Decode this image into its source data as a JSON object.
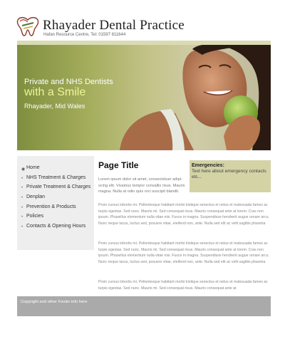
{
  "header": {
    "title": "Rhayader Dental Practice",
    "subtitle": "Hafan Resource Centre, Tel: 01597 811644"
  },
  "hero": {
    "line1": "Private and NHS Dentists",
    "line2": "with a Smile",
    "line3": "Rhayader, Mid Wales"
  },
  "sidebar": {
    "items": [
      {
        "label": "Home",
        "active": true
      },
      {
        "label": "NHS Treatment & Charges"
      },
      {
        "label": "Private Treatment & Charges"
      },
      {
        "label": "Denplan"
      },
      {
        "label": "Prevention & Products"
      },
      {
        "label": "Policies"
      },
      {
        "label": "Contacts & Opening Hours"
      }
    ]
  },
  "main": {
    "page_title": "Page Title",
    "intro": "Lorem ipsum dolor sit amet, consectetuer adipi-scing elit. Vivamus tempor convallis risus. Mauris magna. Nulla at odio quis orci suscipit blandit.",
    "paragraphs": [
      "Proin cursus lobortis mi. Pellentesque habitant morbi tristique senectus et netus et malesuada fames ac turpis egestas. Sed nunc. Mauris mi. Sed consequat risus. Mauris consequat ante at lorem. Cras non ipsum. Phasellus elementum nulla vitae nisi. Fusce in magna. Suspendisse hendrerit augue ornare arcu. Nunc neque lacus, luctus sed, posuere vitae, eleifend non, ante. Nulla sed elit ac velit sagittis pharetra",
      "Proin cursus lobortis mi. Pellentesque habitant morbi tristique senectus et netus et malesuada fames ac turpis egestas. Sed nunc. Mauris mi. Sed consequat risus. Mauris consequat ante at lorem. Cras non ipsum. Phasellus elementum nulla vitae nisi. Fusce in magna. Suspendisse hendrerit augue ornare arcu. Nunc neque lacus, luctus sed, posuere vitae, eleifend non, ante. Nulla sed elit ac velit sagittis pharetra",
      "Proin cursus lobortis mi. Pellentesque habitant morbi tristique senectus et netus et malesuada fames ac turpis egestas. Sed nunc. Mauris mi. Sed consequat risus. Mauris consequat ante at"
    ]
  },
  "emergencies": {
    "title": "Emergencies:",
    "body": "Text here about emergency contacts etc..."
  },
  "footer": {
    "text": "Copyright and other Footer info here"
  },
  "icons": {
    "logo": "tooth-logo-icon",
    "bullet": "bullet-icon",
    "active_bullet": "radio-bullet-icon"
  },
  "colors": {
    "accent_bar": "#d9dbb4",
    "emergency_bg": "#d4d3a6",
    "sidebar_bg": "#eeeeee",
    "footer_bg": "#aaaaaa",
    "hero_highlight": "#eef59a"
  }
}
